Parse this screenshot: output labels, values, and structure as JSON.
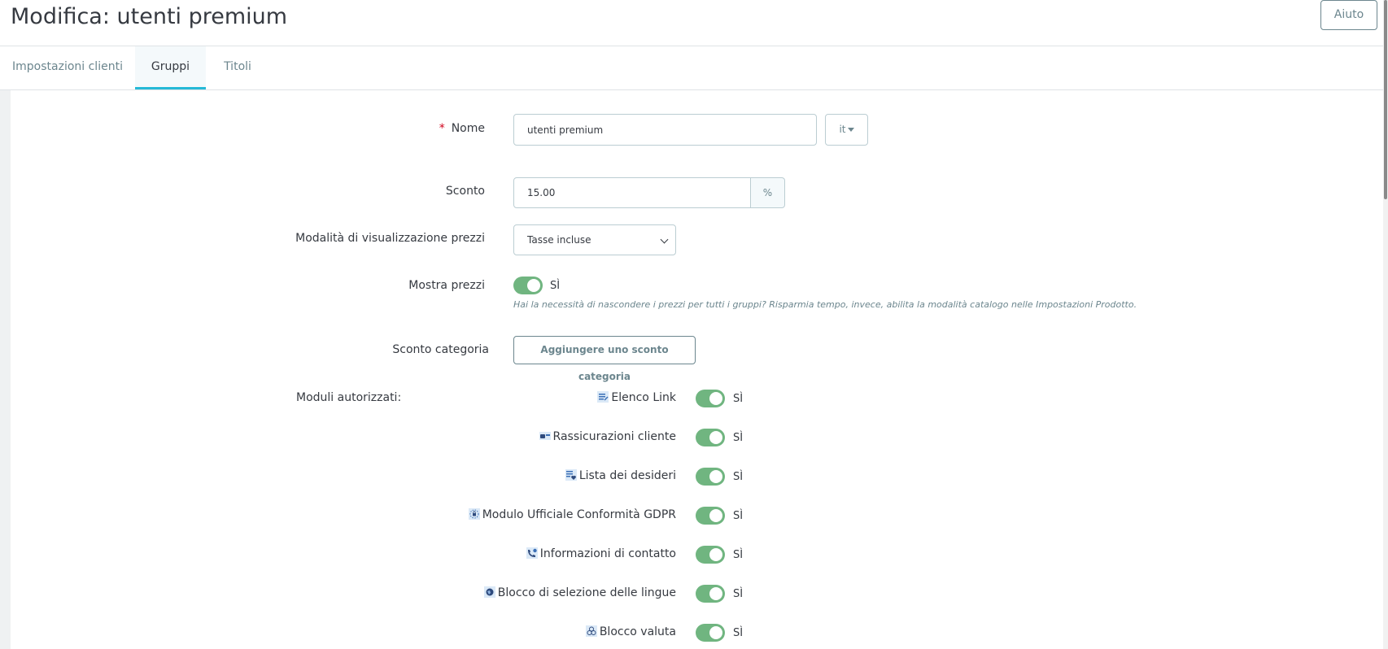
{
  "header": {
    "title": "Modifica: utenti premium",
    "help_label": "Aiuto"
  },
  "tabs": [
    {
      "label": "Impostazioni clienti",
      "active": false
    },
    {
      "label": "Gruppi",
      "active": true
    },
    {
      "label": "Titoli",
      "active": false
    }
  ],
  "form": {
    "name": {
      "required_mark": "*",
      "label": "Nome",
      "value": "utenti premium",
      "language": "it"
    },
    "discount": {
      "label": "Sconto",
      "value": "15.00",
      "unit": "%"
    },
    "price_display": {
      "label": "Modalità di visualizzazione prezzi",
      "selected": "Tasse incluse"
    },
    "show_prices": {
      "label": "Mostra prezzi",
      "state_label": "SÌ",
      "on": true,
      "help": "Hai la necessità di nascondere i prezzi per tutti i gruppi? Risparmia tempo, invece, abilita la modalità catalogo nelle Impostazioni Prodotto."
    },
    "category_discount": {
      "label": "Sconto categoria",
      "button_label": "Aggiungere uno sconto categoria"
    },
    "modules": {
      "label": "Moduli autorizzati:",
      "items": [
        {
          "name": "Elenco Link",
          "icon": "link-list-icon",
          "state_label": "SÌ",
          "on": true
        },
        {
          "name": "Rassicurazioni cliente",
          "icon": "reassurance-icon",
          "state_label": "SÌ",
          "on": true
        },
        {
          "name": "Lista dei desideri",
          "icon": "wishlist-icon",
          "state_label": "SÌ",
          "on": true
        },
        {
          "name": "Modulo Ufficiale Conformità GDPR",
          "icon": "gdpr-icon",
          "state_label": "SÌ",
          "on": true
        },
        {
          "name": "Informazioni di contatto",
          "icon": "contact-icon",
          "state_label": "SÌ",
          "on": true
        },
        {
          "name": "Blocco di selezione delle lingue",
          "icon": "language-icon",
          "state_label": "SÌ",
          "on": true
        },
        {
          "name": "Blocco valuta",
          "icon": "currency-icon",
          "state_label": "SÌ",
          "on": true
        }
      ]
    }
  },
  "colors": {
    "switch_on": "#70b580",
    "tab_active_border": "#25b9d7",
    "required": "#d0021b",
    "muted_text": "#6c868e"
  }
}
